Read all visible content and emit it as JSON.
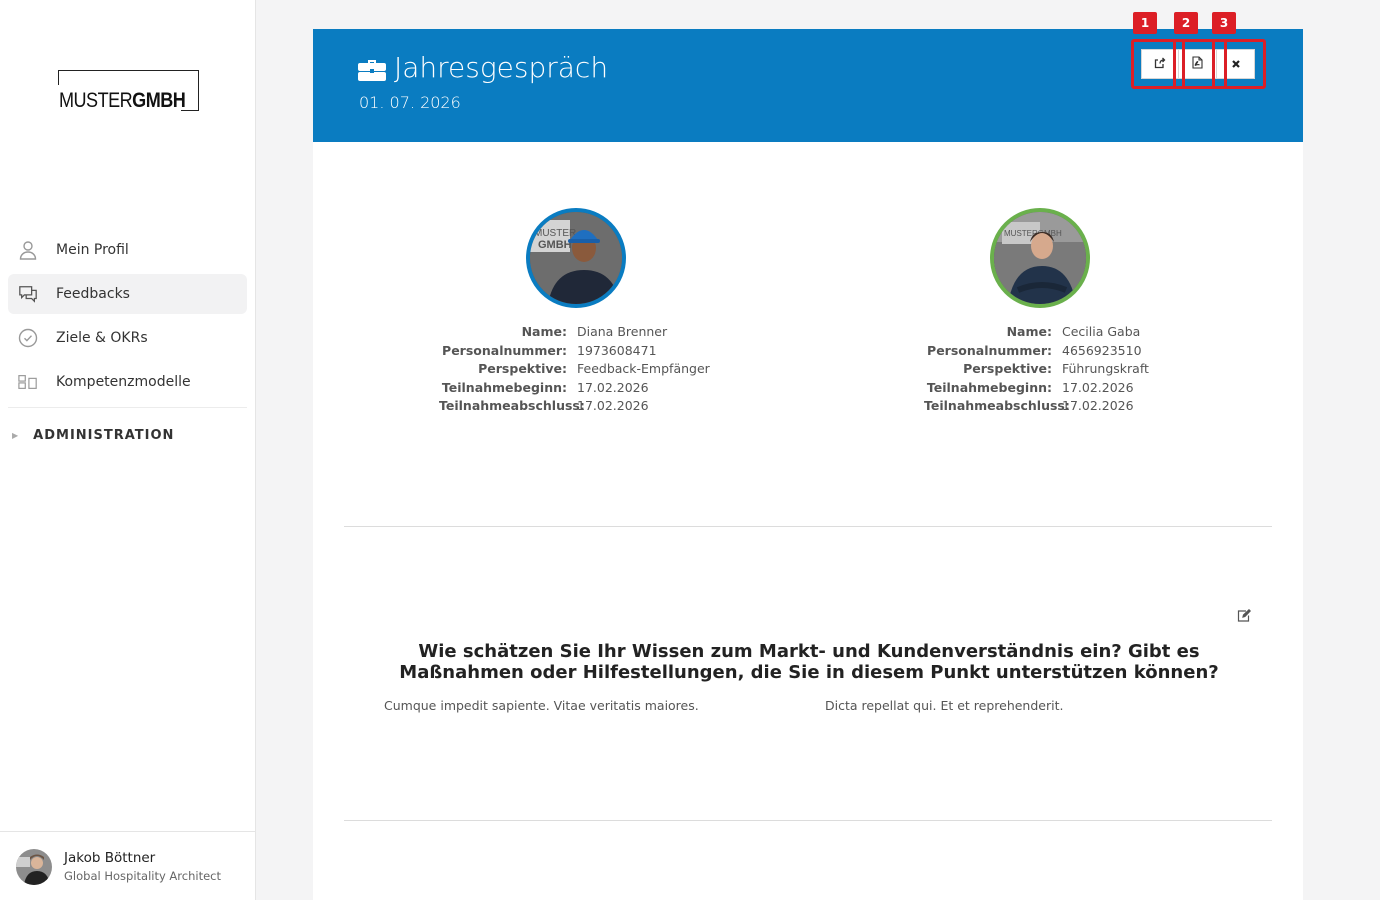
{
  "sidebar": {
    "logo": {
      "light": "MUSTER",
      "bold": "GMBH"
    },
    "items": [
      {
        "label": "Mein Profil",
        "icon": "user-icon",
        "active": false
      },
      {
        "label": "Feedbacks",
        "icon": "chat-icon",
        "active": true
      },
      {
        "label": "Ziele & OKRs",
        "icon": "check-circle-icon",
        "active": false
      },
      {
        "label": "Kompetenzmodelle",
        "icon": "grid-icon",
        "active": false
      }
    ],
    "admin_label": "ADMINISTRATION",
    "user": {
      "name": "Jakob Böttner",
      "role": "Global Hospitality Architect"
    }
  },
  "header": {
    "title": "Jahresgespräch",
    "date": "01. 07. 2026",
    "buttons": [
      {
        "icon": "share-icon",
        "badge": "1"
      },
      {
        "icon": "pdf-icon",
        "badge": "2"
      },
      {
        "icon": "close-icon",
        "badge": "3"
      }
    ]
  },
  "participants": {
    "labels": {
      "name": "Name:",
      "personnel": "Personalnummer:",
      "perspective": "Perspektive:",
      "start": "Teilnahmebeginn:",
      "end": "Teilnahmeabschluss:"
    },
    "left": {
      "name": "Diana Brenner",
      "personnel": "1973608471",
      "perspective": "Feedback-Empfänger",
      "start": "17.02.2026",
      "end": "17.02.2026",
      "ring_color": "#0a7cc1"
    },
    "right": {
      "name": "Cecilia Gaba",
      "personnel": "4656923510",
      "perspective": "Führungskraft",
      "start": "17.02.2026",
      "end": "17.02.2026",
      "ring_color": "#6ab04c"
    }
  },
  "question": {
    "text": "Wie schätzen Sie Ihr Wissen zum Markt- und Kundenverständnis ein? Gibt es Maßnahmen oder Hilfestellungen, die Sie in diesem Punkt unterstützen können?",
    "answer_left": "Cumque impedit sapiente. Vitae veritatis maiores.",
    "answer_right": "Dicta repellat qui. Et et reprehenderit."
  }
}
